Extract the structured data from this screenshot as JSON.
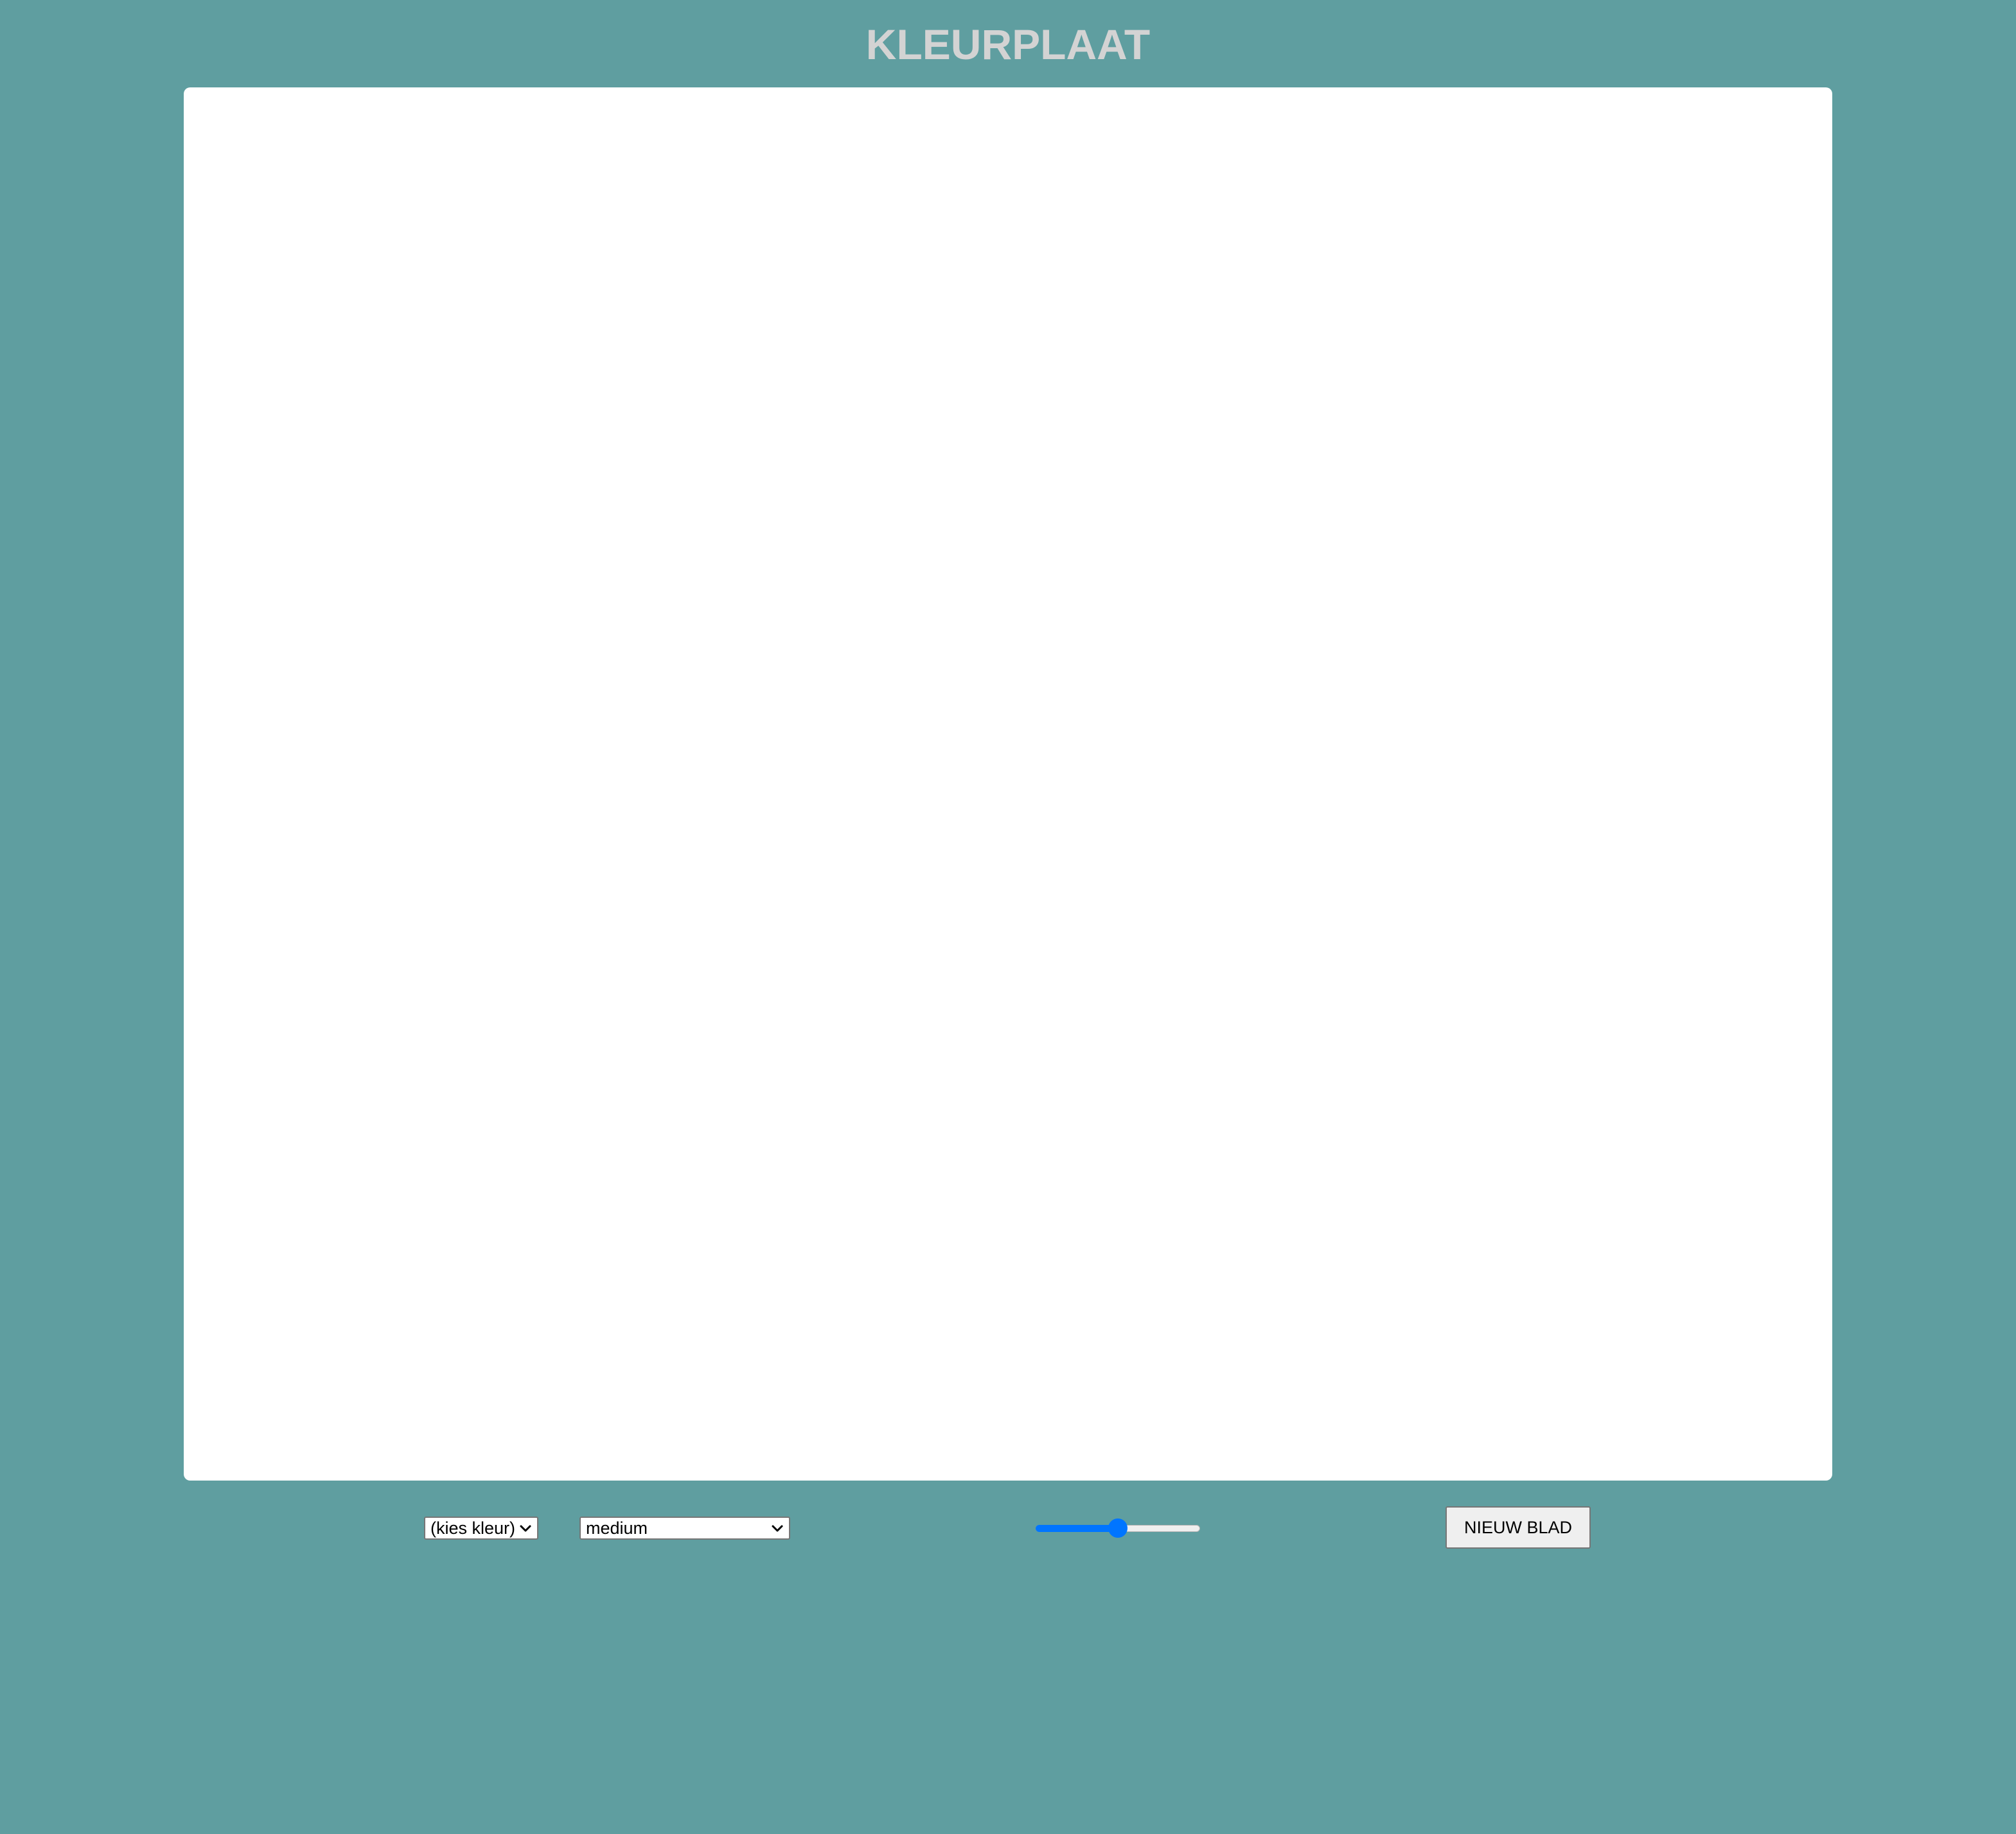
{
  "page": {
    "title": "KLEURPLAAT"
  },
  "controls": {
    "color_select": {
      "selected": "(kies kleur)"
    },
    "size_select": {
      "selected": "medium"
    },
    "slider": {
      "value_fraction": 0.5
    },
    "new_sheet_button": {
      "label": "NIEUW BLAD"
    }
  },
  "colors": {
    "background": "#5f9ea0",
    "title": "#d3d3d3",
    "canvas": "#ffffff",
    "accent": "#0075ff"
  },
  "icons": {
    "select_arrow": "chevron-down-icon"
  }
}
